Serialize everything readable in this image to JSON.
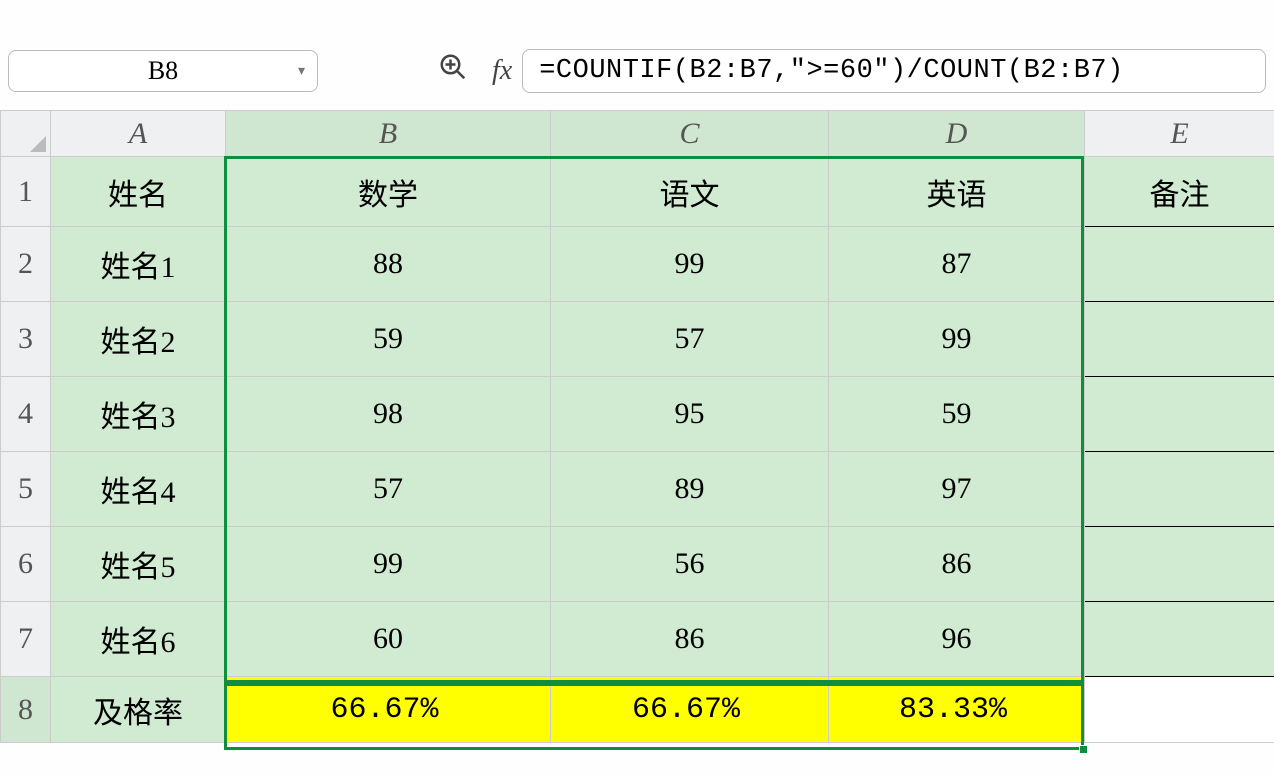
{
  "nameBox": "B8",
  "fxLabel": "fx",
  "formula": "=COUNTIF(B2:B7,\">=60\")/COUNT(B2:B7)",
  "columns": [
    "A",
    "B",
    "C",
    "D",
    "E"
  ],
  "rowNums": [
    "1",
    "2",
    "3",
    "4",
    "5",
    "6",
    "7",
    "8"
  ],
  "header": {
    "A": "姓名",
    "B": "数学",
    "C": "语文",
    "D": "英语",
    "E": "备注"
  },
  "rows": [
    {
      "A": "姓名1",
      "B": "88",
      "C": "99",
      "D": "87",
      "E": ""
    },
    {
      "A": "姓名2",
      "B": "59",
      "C": "57",
      "D": "99",
      "E": ""
    },
    {
      "A": "姓名3",
      "B": "98",
      "C": "95",
      "D": "59",
      "E": ""
    },
    {
      "A": "姓名4",
      "B": "57",
      "C": "89",
      "D": "97",
      "E": ""
    },
    {
      "A": "姓名5",
      "B": "99",
      "C": "56",
      "D": "86",
      "E": ""
    },
    {
      "A": "姓名6",
      "B": "60",
      "C": "86",
      "D": "96",
      "E": ""
    }
  ],
  "result": {
    "A": "及格率",
    "B": "66.67%",
    "C": "66.67%",
    "D": "83.33%",
    "E": ""
  }
}
